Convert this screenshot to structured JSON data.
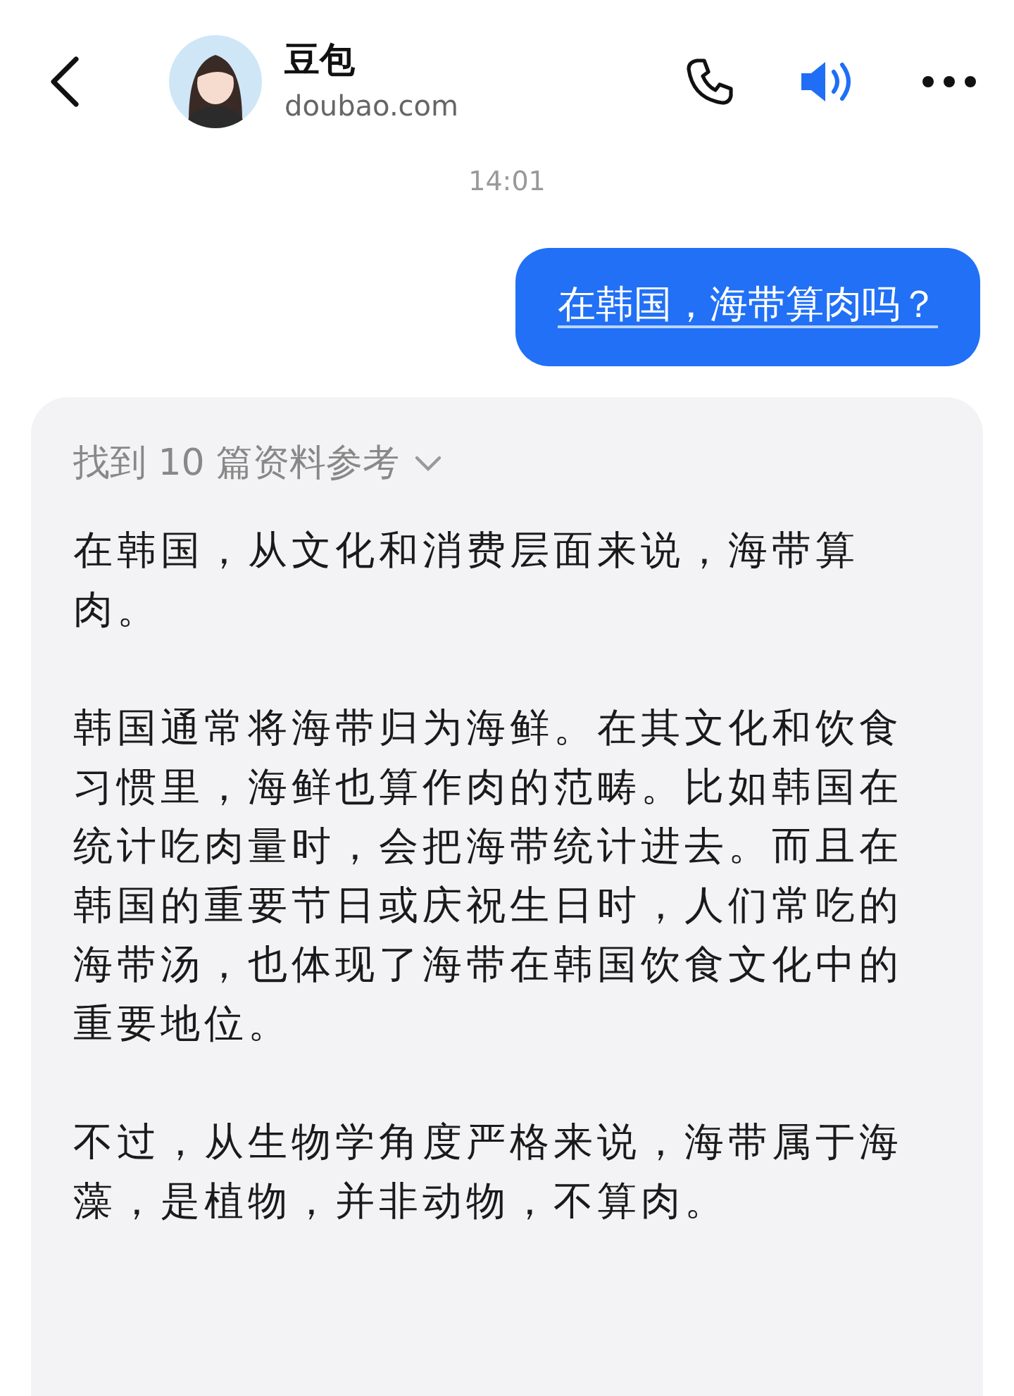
{
  "header": {
    "name": "豆包",
    "subtitle": "doubao.com",
    "speaker_on": true
  },
  "timestamp": "14:01",
  "user_message": {
    "text": "在韩国，海带算肉吗？"
  },
  "reply": {
    "sources": {
      "label": "找到 10 篇资料参考",
      "expanded": false
    },
    "paragraphs": [
      "在韩国，从文化和消费层面来说，海带算肉。",
      "韩国通常将海带归为海鲜。在其文化和饮食习惯里，海鲜也算作肉的范畴。比如韩国在统计吃肉量时，会把海带统计进去。而且在韩国的重要节日或庆祝生日时，人们常吃的海带汤，也体现了海带在韩国饮食文化中的重要地位。",
      "不过，从生物学角度严格来说，海带属于海藻，是植物，并非动物，不算肉。"
    ]
  }
}
